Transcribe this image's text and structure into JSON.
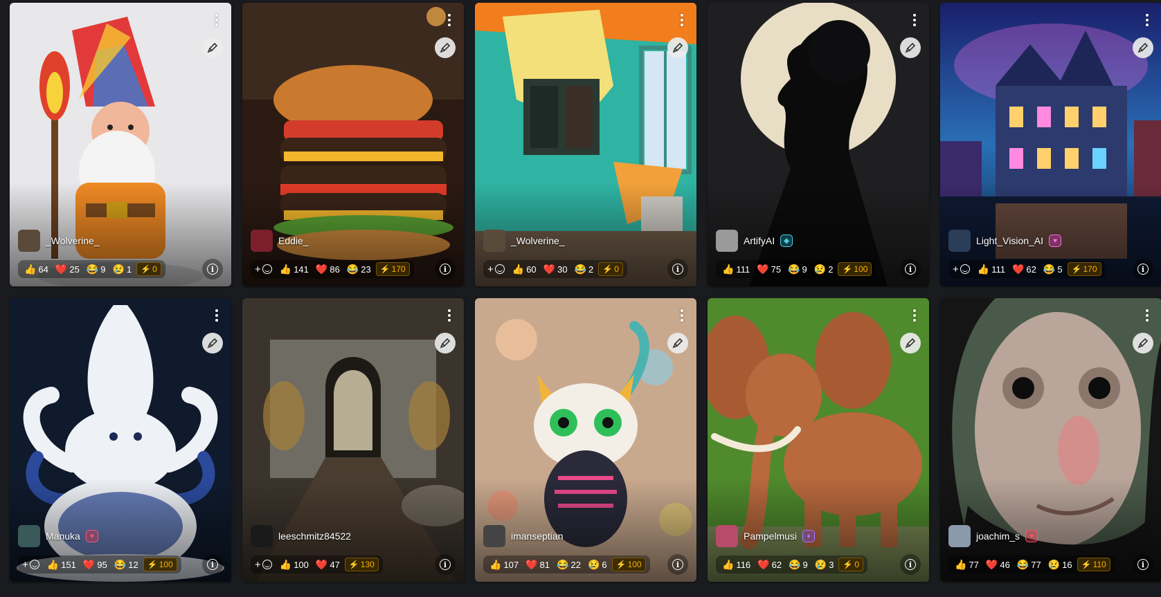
{
  "colors": {
    "page_bg": "#1a1b1e",
    "buzz": "#fab005",
    "heart": "#e03131"
  },
  "ui": {
    "add_glyph": "+",
    "info_glyph": "i"
  },
  "cards": [
    {
      "id": "gnome",
      "username": "_Wolverine_",
      "user_badge": null,
      "show_add": false,
      "reactions": [
        {
          "emoji": "👍",
          "count": "64"
        },
        {
          "emoji": "❤️",
          "count": "25"
        },
        {
          "emoji": "😂",
          "count": "9"
        },
        {
          "emoji": "😢",
          "count": "1"
        }
      ],
      "buzz": "0"
    },
    {
      "id": "burger",
      "username": "Eddie_",
      "user_badge": null,
      "show_add": true,
      "reactions": [
        {
          "emoji": "👍",
          "count": "141"
        },
        {
          "emoji": "❤️",
          "count": "86"
        },
        {
          "emoji": "😂",
          "count": "23"
        }
      ],
      "buzz": "170"
    },
    {
      "id": "room",
      "username": "_Wolverine_",
      "user_badge": null,
      "show_add": true,
      "reactions": [
        {
          "emoji": "👍",
          "count": "60"
        },
        {
          "emoji": "❤️",
          "count": "30"
        },
        {
          "emoji": "😂",
          "count": "2"
        }
      ],
      "buzz": "0"
    },
    {
      "id": "silhouette",
      "username": "ArtifyAI",
      "user_badge": "teal",
      "show_add": false,
      "reactions": [
        {
          "emoji": "👍",
          "count": "111"
        },
        {
          "emoji": "❤️",
          "count": "75"
        },
        {
          "emoji": "😂",
          "count": "9"
        },
        {
          "emoji": "😢",
          "count": "2"
        }
      ],
      "buzz": "100"
    },
    {
      "id": "city",
      "username": "Light_Vision_AI",
      "user_badge": "pink",
      "show_add": true,
      "reactions": [
        {
          "emoji": "👍",
          "count": "111"
        },
        {
          "emoji": "❤️",
          "count": "62"
        },
        {
          "emoji": "😂",
          "count": "5"
        }
      ],
      "buzz": "170"
    },
    {
      "id": "octopus",
      "username": "Manuka",
      "user_badge": "red",
      "show_add": true,
      "reactions": [
        {
          "emoji": "👍",
          "count": "151"
        },
        {
          "emoji": "❤️",
          "count": "95"
        },
        {
          "emoji": "😂",
          "count": "12"
        }
      ],
      "buzz": "100"
    },
    {
      "id": "tunnel",
      "username": "leeschmitz84522",
      "user_badge": null,
      "show_add": true,
      "reactions": [
        {
          "emoji": "👍",
          "count": "100"
        },
        {
          "emoji": "❤️",
          "count": "47"
        }
      ],
      "buzz": "130"
    },
    {
      "id": "cat",
      "username": "imanseptian",
      "user_badge": null,
      "show_add": false,
      "reactions": [
        {
          "emoji": "👍",
          "count": "107"
        },
        {
          "emoji": "❤️",
          "count": "81"
        },
        {
          "emoji": "😂",
          "count": "22"
        },
        {
          "emoji": "😢",
          "count": "6"
        }
      ],
      "buzz": "100"
    },
    {
      "id": "elephant",
      "username": "Pampelmusi",
      "user_badge": "purple",
      "show_add": false,
      "reactions": [
        {
          "emoji": "👍",
          "count": "116"
        },
        {
          "emoji": "❤️",
          "count": "62"
        },
        {
          "emoji": "😂",
          "count": "9"
        },
        {
          "emoji": "😢",
          "count": "3"
        }
      ],
      "buzz": "0"
    },
    {
      "id": "oldman",
      "username": "joachim_s",
      "user_badge": "red",
      "show_add": false,
      "reactions": [
        {
          "emoji": "👍",
          "count": "77"
        },
        {
          "emoji": "❤️",
          "count": "46"
        },
        {
          "emoji": "😂",
          "count": "77"
        },
        {
          "emoji": "😢",
          "count": "16"
        }
      ],
      "buzz": "110"
    }
  ]
}
